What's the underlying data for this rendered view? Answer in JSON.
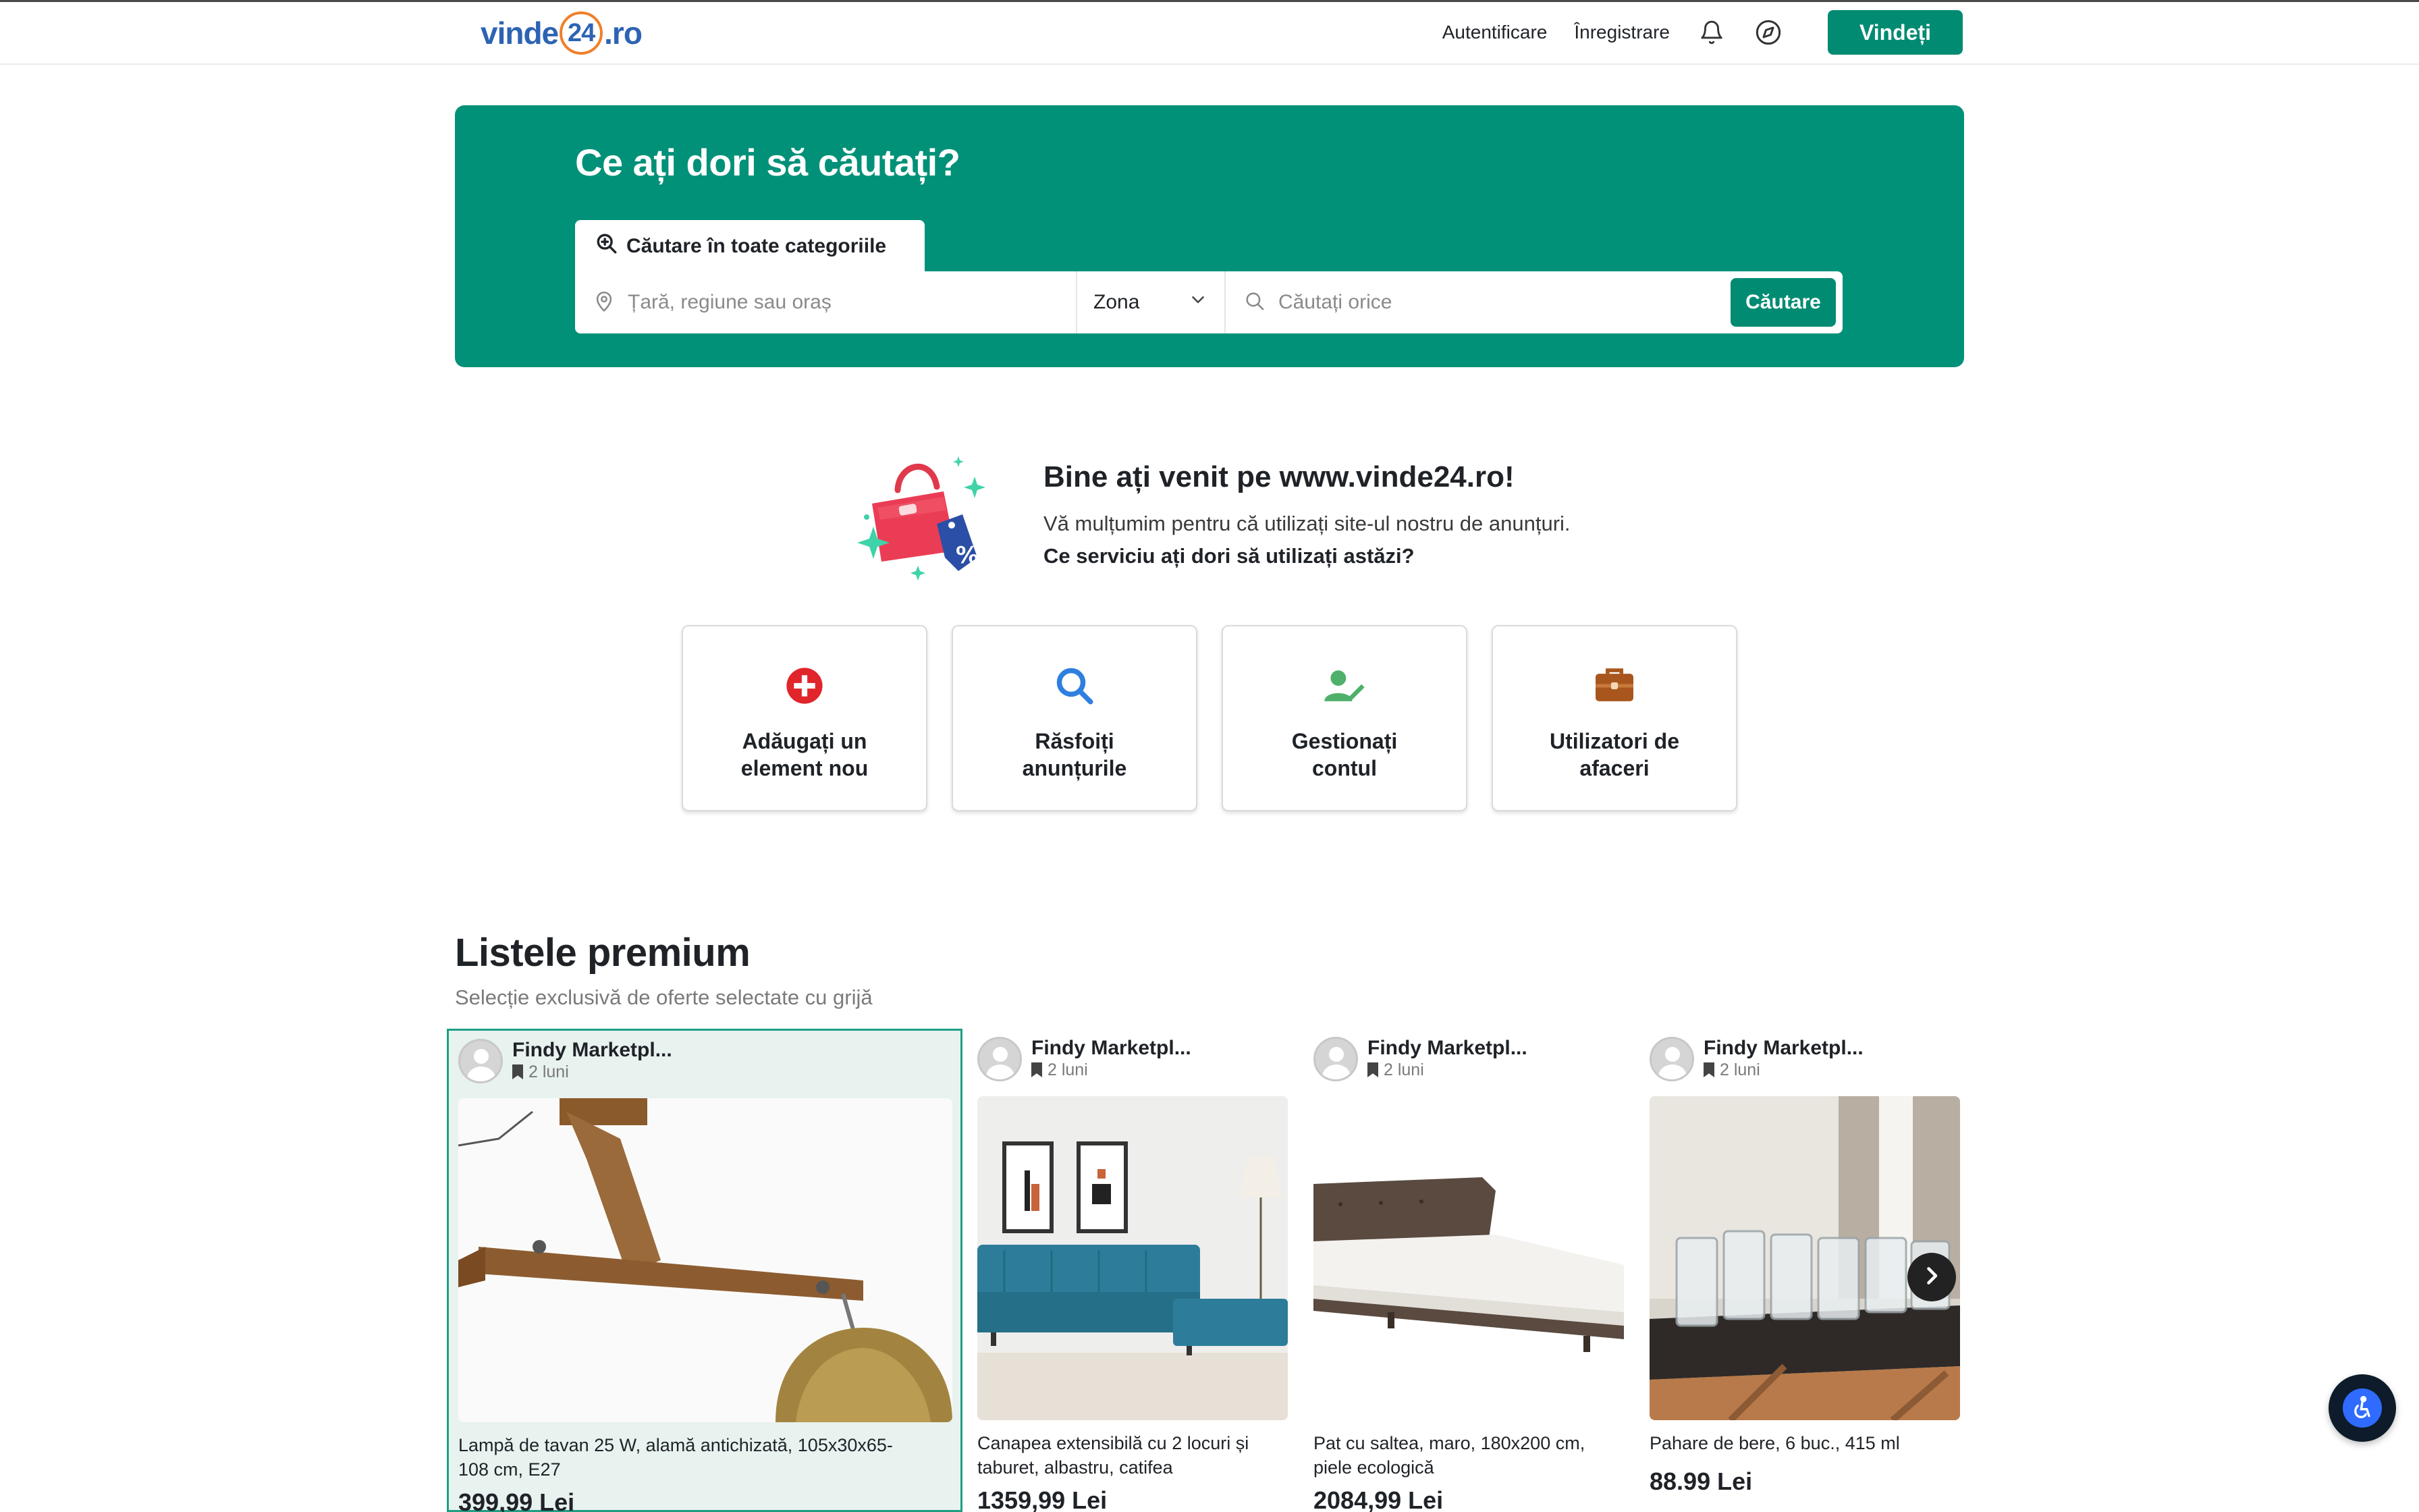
{
  "header": {
    "logo_left": "vinde",
    "logo_ring": "24",
    "logo_right": ".ro",
    "login": "Autentificare",
    "register": "Înregistrare",
    "sell": "Vindeți",
    "icons": [
      "bell-icon",
      "compass-icon"
    ]
  },
  "hero": {
    "title": "Ce ați dori să căutați?",
    "tab_label": "Căutare în toate categoriile",
    "location_placeholder": "Țară, regiune sau oraș",
    "zone_label": "Zona",
    "query_placeholder": "Căutați orice",
    "search_button": "Căutare"
  },
  "welcome": {
    "title": "Bine ați venit pe www.vinde24.ro!",
    "text": "Vă mulțumim pentru că utilizați site-ul nostru de anunțuri.",
    "question": "Ce serviciu ați dori să utilizați astăzi?",
    "badge_symbol": "%"
  },
  "services": [
    {
      "label": "Adăugați un element nou",
      "icon": "plus-circle-icon",
      "color": "#e0252b"
    },
    {
      "label": "Răsfoiți anunțurile",
      "icon": "magnifier-icon",
      "color": "#2f7fe0"
    },
    {
      "label": "Gestionați contul",
      "icon": "user-edit-icon",
      "color": "#4fb06b"
    },
    {
      "label": "Utilizatori de afaceri",
      "icon": "briefcase-icon",
      "color": "#a8561d"
    }
  ],
  "premium": {
    "title": "Listele premium",
    "subtitle": "Selecție exclusivă de oferte selectate cu grijă",
    "listings": [
      {
        "seller": "Findy Marketpl...",
        "ago": "2 luni",
        "title_line1": "Lampă de tavan 25 W, alamă antichizată, 105x30x65-",
        "title_line2": "108 cm, E27",
        "price": "399,99 Lei"
      },
      {
        "seller": "Findy Marketpl...",
        "ago": "2 luni",
        "title_line1": "Canapea extensibilă cu 2 locuri și",
        "title_line2": "taburet, albastru, catifea",
        "price": "1359,99 Lei"
      },
      {
        "seller": "Findy Marketpl...",
        "ago": "2 luni",
        "title_line1": "Pat cu saltea, maro, 180x200 cm,",
        "title_line2": "piele ecologică",
        "price": "2084,99 Lei"
      },
      {
        "seller": "Findy Marketpl...",
        "ago": "2 luni",
        "title_line1": "Pahare de bere, 6 buc., 415 ml",
        "title_line2": "",
        "price": "88.99 Lei"
      }
    ]
  },
  "colors": {
    "brand_green": "#008b72",
    "hero_green": "#009178",
    "logo_blue": "#2d63b3",
    "logo_orange": "#f07f2a"
  }
}
